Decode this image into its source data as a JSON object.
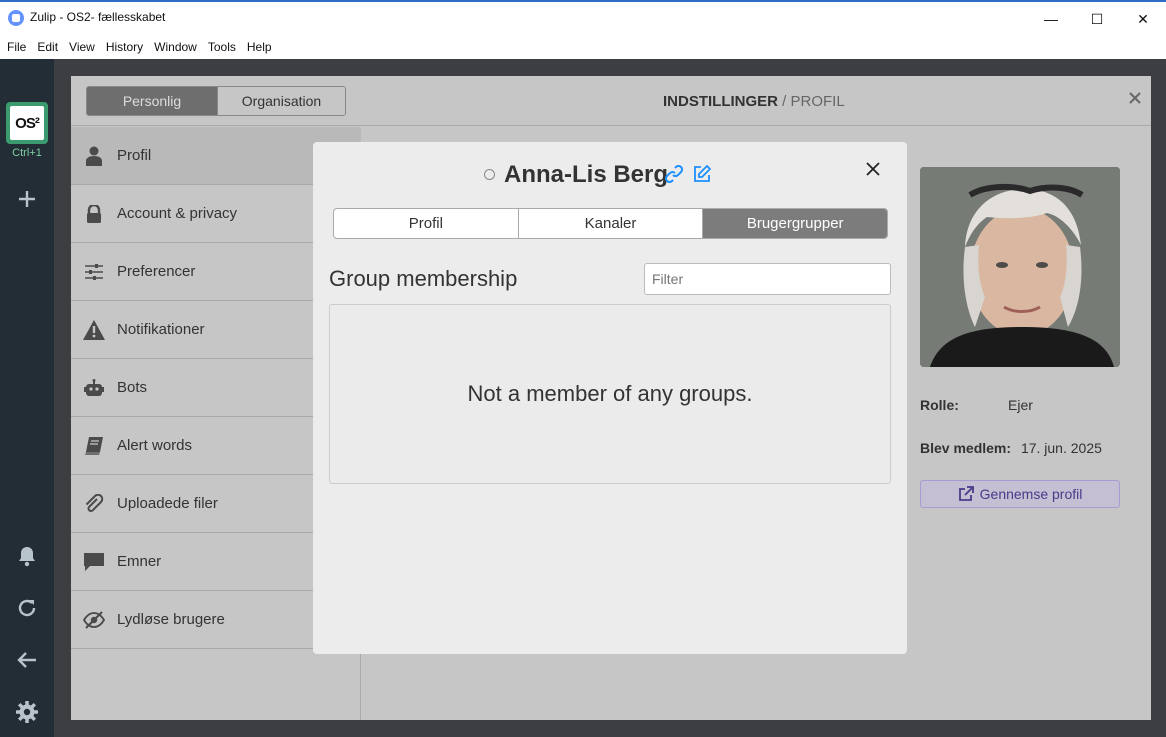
{
  "window": {
    "title": "Zulip - OS2- fællesskabet",
    "minimize": "—",
    "maximize": "☐",
    "close": "✕"
  },
  "menu": [
    "File",
    "Edit",
    "View",
    "History",
    "Window",
    "Tools",
    "Help"
  ],
  "rail": {
    "org_logo_text": "OS²",
    "org_shortcut": "Ctrl+1"
  },
  "settings": {
    "toggle": {
      "personal": "Personlig",
      "organization": "Organisation"
    },
    "title": "INDSTILLINGER",
    "subtitle": "/ PROFIL",
    "sidebar": [
      {
        "label": "Profil",
        "icon": "user-icon"
      },
      {
        "label": "Account & privacy",
        "icon": "lock-icon"
      },
      {
        "label": "Preferencer",
        "icon": "sliders-icon"
      },
      {
        "label": "Notifikationer",
        "icon": "warning-icon"
      },
      {
        "label": "Bots",
        "icon": "robot-icon"
      },
      {
        "label": "Alert words",
        "icon": "book-icon"
      },
      {
        "label": "Uploadede filer",
        "icon": "paperclip-icon"
      },
      {
        "label": "Emner",
        "icon": "message-icon"
      },
      {
        "label": "Lydløse brugere",
        "icon": "eye-slash-icon"
      }
    ]
  },
  "profile_card": {
    "role_label": "Rolle:",
    "role_value": "Ejer",
    "joined_label": "Blev medlem:",
    "joined_value": "17. jun. 2025",
    "view_profile": "Gennemse profil"
  },
  "modal": {
    "name": "Anna-Lis Berg",
    "tabs": [
      {
        "label": "Profil",
        "active": false
      },
      {
        "label": "Kanaler",
        "active": false
      },
      {
        "label": "Brugergrupper",
        "active": true
      }
    ],
    "section_title": "Group membership",
    "filter_placeholder": "Filter",
    "empty_text": "Not a member of any groups."
  }
}
